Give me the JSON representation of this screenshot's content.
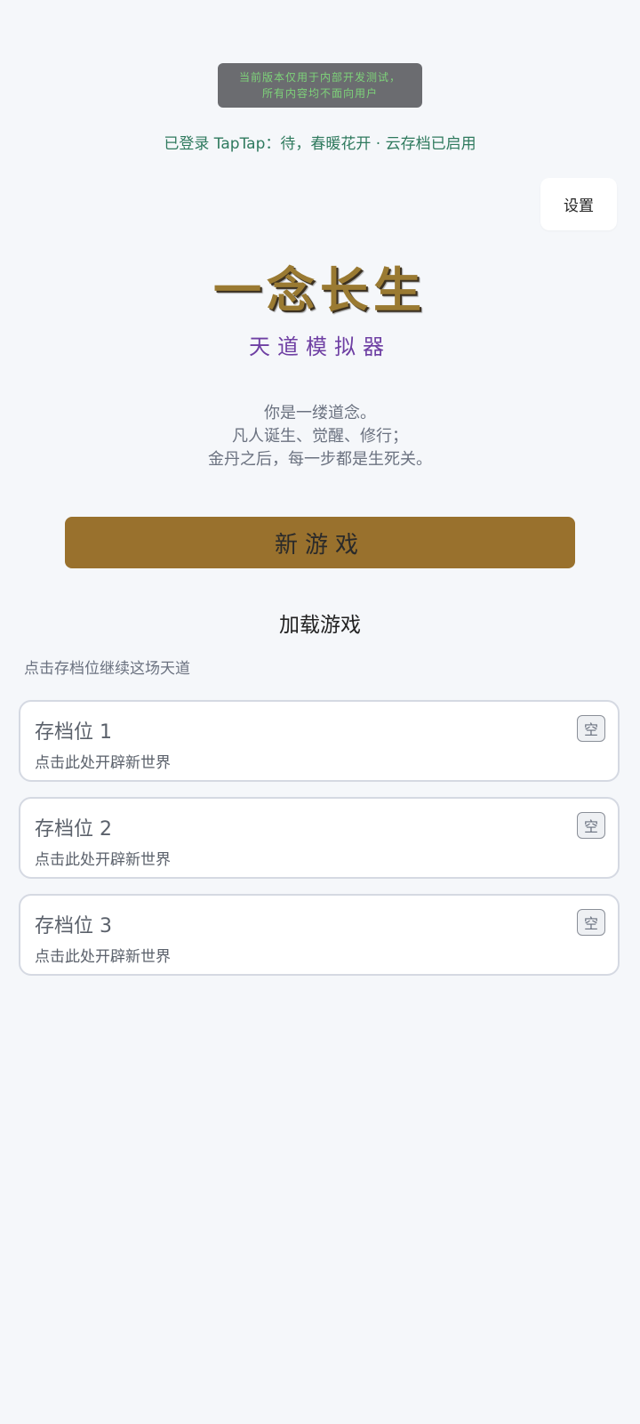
{
  "notice": {
    "line1": "当前版本仅用于内部开发测试，",
    "line2": "所有内容均不面向用户"
  },
  "login_status": "已登录 TapTap：待，春暖花开 · 云存档已启用",
  "settings_label": "设置",
  "title": "一念长生",
  "subtitle": "天道模拟器",
  "intro": {
    "line1": "你是一缕道念。",
    "line2": "凡人诞生、觉醒、修行；",
    "line3": "金丹之后，每一步都是生死关。"
  },
  "new_game_label": "新游戏",
  "load_heading": "加载游戏",
  "load_hint": "点击存档位继续这场天道",
  "slots": [
    {
      "name": "存档位 1",
      "desc": "点击此处开辟新世界",
      "badge": "空"
    },
    {
      "name": "存档位 2",
      "desc": "点击此处开辟新世界",
      "badge": "空"
    },
    {
      "name": "存档位 3",
      "desc": "点击此处开辟新世界",
      "badge": "空"
    }
  ]
}
